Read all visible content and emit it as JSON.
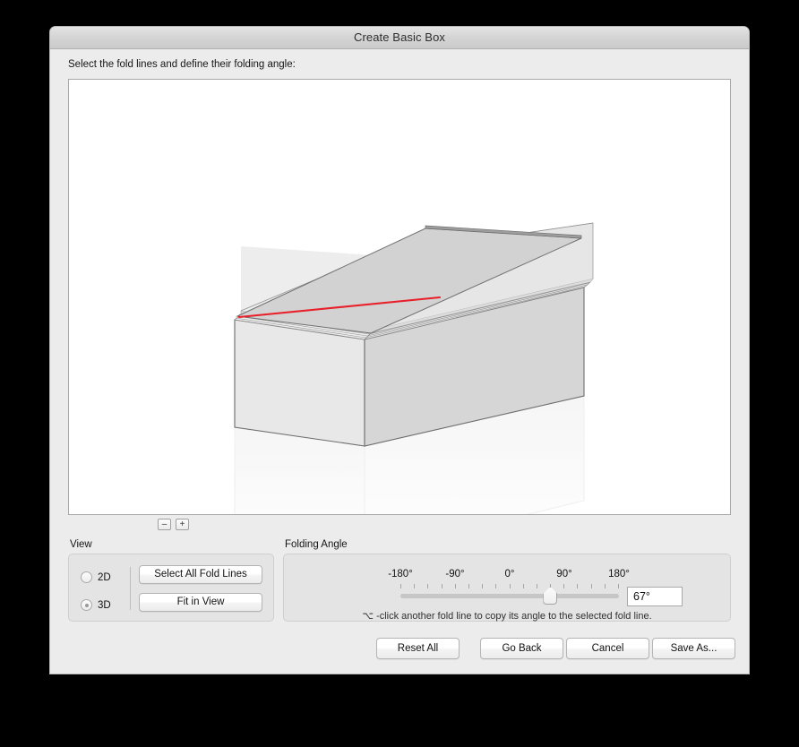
{
  "window": {
    "title": "Create Basic Box",
    "instruction": "Select the fold lines and define their folding angle:"
  },
  "canvas": {
    "zoom_out_label": "–",
    "zoom_in_label": "+",
    "selected_fold_line_color": "#e8202a",
    "background_color": "#ffffff",
    "lid_face_color": "#d2d2d2",
    "body_left_face_color": "#e8e8e8",
    "body_front_face_color": "#d6d6d6",
    "reflection_color": "#f8f8f8"
  },
  "view_panel": {
    "label": "View",
    "options": [
      {
        "label": "2D",
        "selected": false
      },
      {
        "label": "3D",
        "selected": true
      }
    ],
    "select_all_label": "Select All Fold Lines",
    "fit_in_view_label": "Fit in View"
  },
  "folding_angle_panel": {
    "label": "Folding Angle",
    "tick_labels": [
      "-180°",
      "-90°",
      "0°",
      "90°",
      "180°"
    ],
    "tick_count": 17,
    "value": "67°",
    "slider_min": -180,
    "slider_max": 180,
    "slider_value": 67,
    "hint": "⌥ -click another fold line to copy its angle to the selected fold line."
  },
  "actions": {
    "reset_all": "Reset All",
    "go_back": "Go Back",
    "cancel": "Cancel",
    "save_as": "Save As..."
  }
}
